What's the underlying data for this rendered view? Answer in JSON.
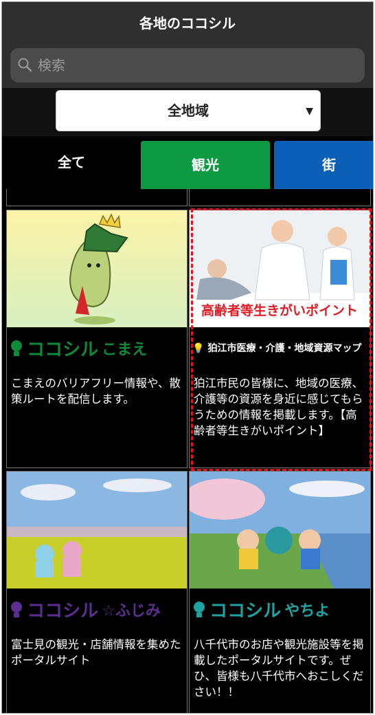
{
  "header": {
    "title": "各地のココシル"
  },
  "search": {
    "placeholder": "検索"
  },
  "region": {
    "selected": "全地域"
  },
  "tabs": [
    {
      "label": "全て"
    },
    {
      "label": "観光"
    },
    {
      "label": "街"
    }
  ],
  "colors": {
    "kanko": "#0d9a43",
    "machi": "#0a5fb6",
    "highlight": "#e0141b"
  },
  "cards": [
    {
      "logo_main": "ココシル",
      "logo_sub": "こまえ",
      "logo_color": "#0e8a3b",
      "description": "こまえのバリアフリー情報や、散策ルートを配信します。"
    },
    {
      "banner": "高齢者等生きがいポイント",
      "logo_main": "狛江市医療・介護・地域資源マップ",
      "description": "狛江市民の皆様に、地域の医療、介護等の資源を身近に感じてもらうための情報を掲載します。【高齢者等生きがいポイント】"
    },
    {
      "logo_main": "ココシル",
      "logo_sub": "☆ふじみ",
      "logo_color": "#5b2f92",
      "description": "富士見の観光・店舗情報を集めたポータルサイト"
    },
    {
      "logo_main": "ココシル",
      "logo_sub": "やちよ",
      "logo_color": "#1ea5a3",
      "description": "八千代市のお店や観光施設等を掲載したポータルサイトです。ぜひ、皆様も八千代市へおこしください！！"
    }
  ]
}
